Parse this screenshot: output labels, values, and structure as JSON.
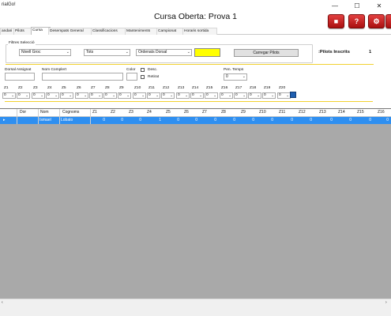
{
  "window": {
    "app_title": "rialGo!",
    "title": "Cursa Oberta: Prova 1",
    "minimize": "—",
    "maximize": "☐",
    "close": "✕"
  },
  "tabs": [
    "andari",
    "Pilots",
    "Cursa",
    "Desempats General",
    "Classificacions",
    "Manteniments",
    "Campionat",
    "Horaris sortida"
  ],
  "active_tab_index": 2,
  "toolbar_icons": [
    "save-icon",
    "help-icon",
    "settings-icon",
    "home-icon"
  ],
  "filters": {
    "group_label": "Filtres Selecció",
    "nivell": "Nivell Groc",
    "tots": "Tots",
    "ordenar": "Ordenats Dorsal",
    "color_swatch": "#ffff00",
    "load_button": "Carregar Pilots",
    "pilots_inscrits_label": ":Pilots Inscrits",
    "pilots_inscrits_count": "1"
  },
  "entry": {
    "dorsal_label": "Dorsal Assignat",
    "nom_label": "Nom Complert",
    "color_label": "Color",
    "desc_label": "Desc.",
    "retirat_label": "Retirat",
    "pen_temps_label": "Pen. Temps",
    "pen_temps_value": "0"
  },
  "zones": {
    "labels": [
      "Z1",
      "Z2",
      "Z3",
      "Z4",
      "Z5",
      "Z6",
      "Z7",
      "Z8",
      "Z9",
      "Z10",
      "Z11",
      "Z12",
      "Z13",
      "Z14",
      "Z15",
      "Z16",
      "Z17",
      "Z18",
      "Z19",
      "Z20"
    ],
    "values": [
      "0",
      "0",
      "0",
      "0",
      "0",
      "0",
      "0",
      "0",
      "0",
      "0",
      "0",
      "0",
      "0",
      "0",
      "0",
      "0",
      "0",
      "0",
      "0",
      "0"
    ]
  },
  "grid": {
    "columns": [
      "Dor",
      "Nom",
      "Cognoms",
      "Z1",
      "Z2",
      "Z3",
      "Z4",
      "Z5",
      "Z6",
      "Z7",
      "Z8",
      "Z9",
      "Z10",
      "Z11",
      "Z12",
      "Z13",
      "Z14",
      "Z15",
      "Z16"
    ],
    "rows": [
      {
        "indicator": "▸",
        "dor": "",
        "nom": "Ismael",
        "cognoms": "Lobato",
        "zones": [
          "0",
          "0",
          "0",
          "1",
          "0",
          "0",
          "0",
          "0",
          "0",
          "0",
          "0",
          "0",
          "0",
          "0",
          "0",
          "0"
        ]
      }
    ]
  },
  "colors": {
    "accent_red": "#c41c1c",
    "selection_blue": "#2f8ff0",
    "grid_background": "#a9a9a9",
    "separator_yellow": "#f2d230"
  }
}
